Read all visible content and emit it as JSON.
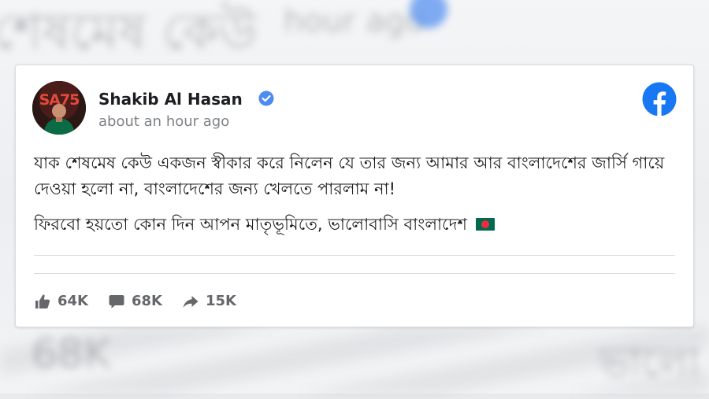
{
  "background": {
    "top_blur_text": "শেষমেষ কেউ",
    "top_blur_ago": "hour ago",
    "bottom_blur_left": "68K",
    "bottom_blur_right": "ভালো"
  },
  "post": {
    "author": "Shakib Al Hasan",
    "verified": true,
    "timestamp": "about an hour ago",
    "platform": "facebook-icon",
    "paragraph1": "যাক শেষমেষ কেউ একজন স্বীকার করে নিলেন যে তার জন্য আমার আর বাংলাদেশের জার্সি গায়ে দেওয়া হলো না, বাংলাদেশের জন্য খেলতে পারলাম না!",
    "paragraph2": "ফিরবো হয়তো কোন দিন আপন মাতৃভূমিতে, ভালোবাসি বাংলাদেশ",
    "flag_icon": "bangladesh-flag-icon"
  },
  "stats": {
    "likes": "64K",
    "comments": "68K",
    "shares": "15K"
  },
  "colors": {
    "facebook_blue": "#1877f2",
    "verified_blue": "#4d8bf0",
    "text_primary": "#1c1e21",
    "text_secondary": "#65676b"
  }
}
